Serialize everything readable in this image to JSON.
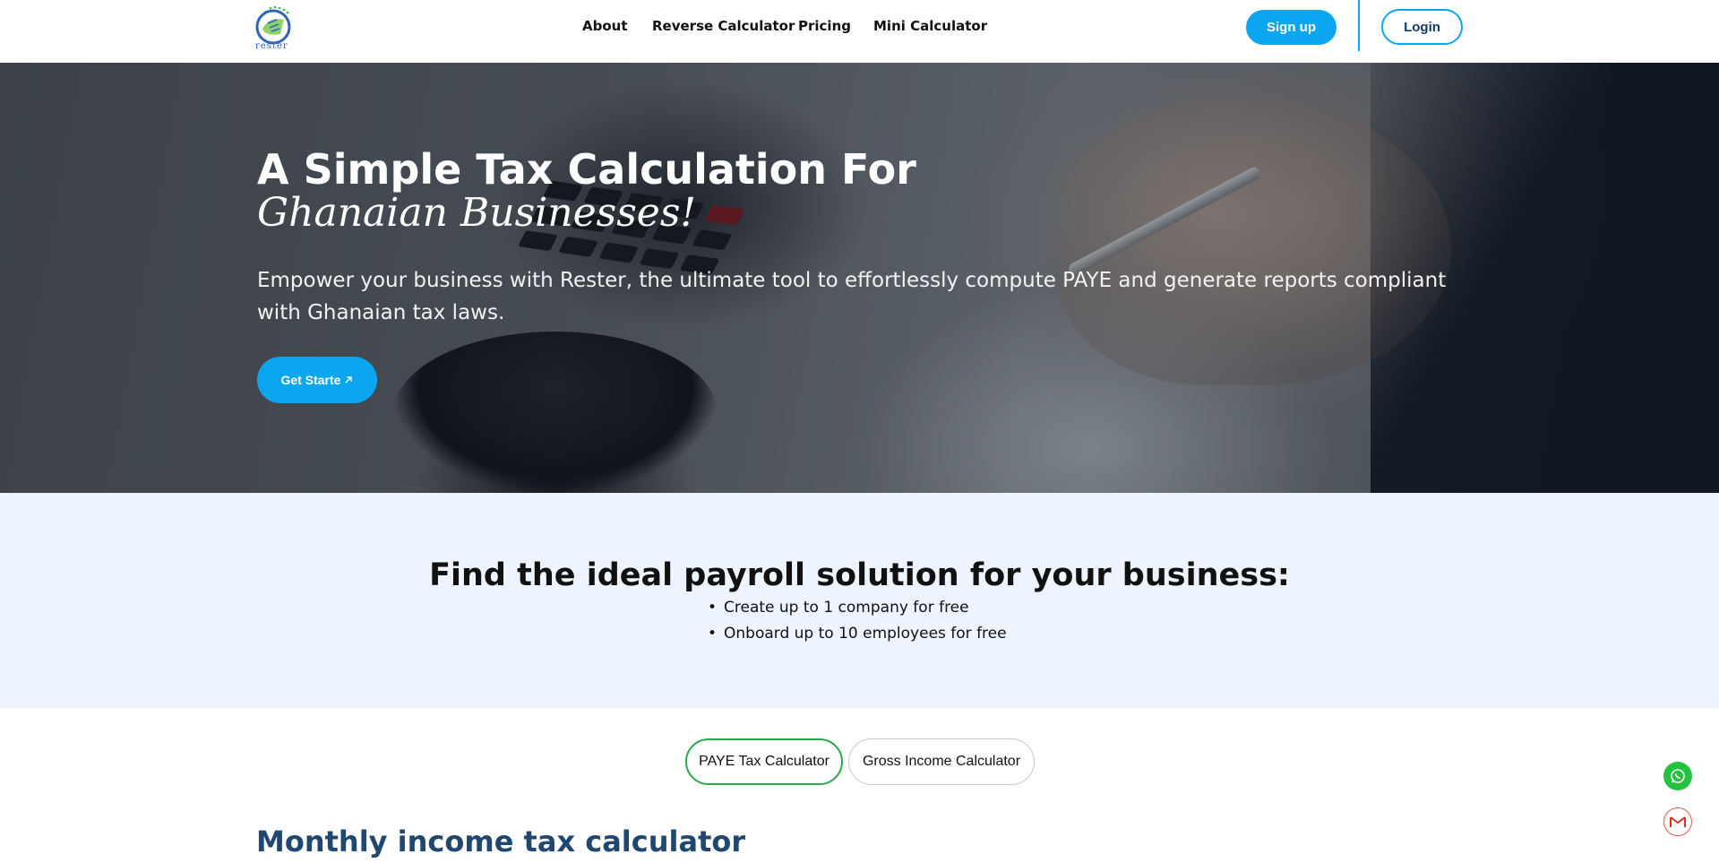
{
  "brand": {
    "name": "rester"
  },
  "nav": {
    "items": [
      {
        "label": "About"
      },
      {
        "label": "Reverse Calculator"
      },
      {
        "label": "Pricing"
      },
      {
        "label": "Mini Calculator"
      }
    ],
    "signup_label": "Sign up",
    "login_label": "Login"
  },
  "hero": {
    "title": "A Simple Tax Calculation For",
    "script": "Ghanaian Businesses!",
    "subtitle": "Empower your business with Rester, the ultimate tool to effortlessly compute PAYE and generate reports compliant with Ghanaian tax laws.",
    "cta_label": "Get Starte",
    "cta_icon": "arrow-up-right-icon"
  },
  "plans": {
    "title": "Find the ideal payroll solution for your business:",
    "bullets": [
      "Create up to 1 company for free",
      "Onboard up to 10 employees for free"
    ]
  },
  "calculator": {
    "tabs": [
      {
        "label": "PAYE Tax Calculator",
        "active": true
      },
      {
        "label": "Gross Income Calculator",
        "active": false
      }
    ],
    "heading": "Monthly income tax calculator"
  },
  "floating": {
    "whatsapp_icon": "whatsapp-icon",
    "mail_icon": "gmail-icon"
  },
  "colors": {
    "accent": "#0aa6ef",
    "active_tab_border": "#2ba84a",
    "heading": "#1f4770",
    "plans_bg": "#edf4fd"
  }
}
